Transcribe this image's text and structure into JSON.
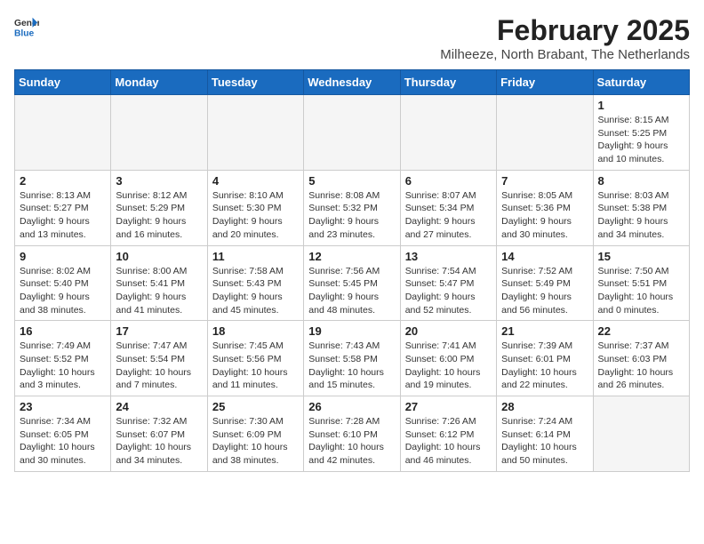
{
  "logo": {
    "general": "General",
    "blue": "Blue"
  },
  "title": "February 2025",
  "subtitle": "Milheeze, North Brabant, The Netherlands",
  "days_header": [
    "Sunday",
    "Monday",
    "Tuesday",
    "Wednesday",
    "Thursday",
    "Friday",
    "Saturday"
  ],
  "weeks": [
    [
      {
        "num": "",
        "info": ""
      },
      {
        "num": "",
        "info": ""
      },
      {
        "num": "",
        "info": ""
      },
      {
        "num": "",
        "info": ""
      },
      {
        "num": "",
        "info": ""
      },
      {
        "num": "",
        "info": ""
      },
      {
        "num": "1",
        "info": "Sunrise: 8:15 AM\nSunset: 5:25 PM\nDaylight: 9 hours and 10 minutes."
      }
    ],
    [
      {
        "num": "2",
        "info": "Sunrise: 8:13 AM\nSunset: 5:27 PM\nDaylight: 9 hours and 13 minutes."
      },
      {
        "num": "3",
        "info": "Sunrise: 8:12 AM\nSunset: 5:29 PM\nDaylight: 9 hours and 16 minutes."
      },
      {
        "num": "4",
        "info": "Sunrise: 8:10 AM\nSunset: 5:30 PM\nDaylight: 9 hours and 20 minutes."
      },
      {
        "num": "5",
        "info": "Sunrise: 8:08 AM\nSunset: 5:32 PM\nDaylight: 9 hours and 23 minutes."
      },
      {
        "num": "6",
        "info": "Sunrise: 8:07 AM\nSunset: 5:34 PM\nDaylight: 9 hours and 27 minutes."
      },
      {
        "num": "7",
        "info": "Sunrise: 8:05 AM\nSunset: 5:36 PM\nDaylight: 9 hours and 30 minutes."
      },
      {
        "num": "8",
        "info": "Sunrise: 8:03 AM\nSunset: 5:38 PM\nDaylight: 9 hours and 34 minutes."
      }
    ],
    [
      {
        "num": "9",
        "info": "Sunrise: 8:02 AM\nSunset: 5:40 PM\nDaylight: 9 hours and 38 minutes."
      },
      {
        "num": "10",
        "info": "Sunrise: 8:00 AM\nSunset: 5:41 PM\nDaylight: 9 hours and 41 minutes."
      },
      {
        "num": "11",
        "info": "Sunrise: 7:58 AM\nSunset: 5:43 PM\nDaylight: 9 hours and 45 minutes."
      },
      {
        "num": "12",
        "info": "Sunrise: 7:56 AM\nSunset: 5:45 PM\nDaylight: 9 hours and 48 minutes."
      },
      {
        "num": "13",
        "info": "Sunrise: 7:54 AM\nSunset: 5:47 PM\nDaylight: 9 hours and 52 minutes."
      },
      {
        "num": "14",
        "info": "Sunrise: 7:52 AM\nSunset: 5:49 PM\nDaylight: 9 hours and 56 minutes."
      },
      {
        "num": "15",
        "info": "Sunrise: 7:50 AM\nSunset: 5:51 PM\nDaylight: 10 hours and 0 minutes."
      }
    ],
    [
      {
        "num": "16",
        "info": "Sunrise: 7:49 AM\nSunset: 5:52 PM\nDaylight: 10 hours and 3 minutes."
      },
      {
        "num": "17",
        "info": "Sunrise: 7:47 AM\nSunset: 5:54 PM\nDaylight: 10 hours and 7 minutes."
      },
      {
        "num": "18",
        "info": "Sunrise: 7:45 AM\nSunset: 5:56 PM\nDaylight: 10 hours and 11 minutes."
      },
      {
        "num": "19",
        "info": "Sunrise: 7:43 AM\nSunset: 5:58 PM\nDaylight: 10 hours and 15 minutes."
      },
      {
        "num": "20",
        "info": "Sunrise: 7:41 AM\nSunset: 6:00 PM\nDaylight: 10 hours and 19 minutes."
      },
      {
        "num": "21",
        "info": "Sunrise: 7:39 AM\nSunset: 6:01 PM\nDaylight: 10 hours and 22 minutes."
      },
      {
        "num": "22",
        "info": "Sunrise: 7:37 AM\nSunset: 6:03 PM\nDaylight: 10 hours and 26 minutes."
      }
    ],
    [
      {
        "num": "23",
        "info": "Sunrise: 7:34 AM\nSunset: 6:05 PM\nDaylight: 10 hours and 30 minutes."
      },
      {
        "num": "24",
        "info": "Sunrise: 7:32 AM\nSunset: 6:07 PM\nDaylight: 10 hours and 34 minutes."
      },
      {
        "num": "25",
        "info": "Sunrise: 7:30 AM\nSunset: 6:09 PM\nDaylight: 10 hours and 38 minutes."
      },
      {
        "num": "26",
        "info": "Sunrise: 7:28 AM\nSunset: 6:10 PM\nDaylight: 10 hours and 42 minutes."
      },
      {
        "num": "27",
        "info": "Sunrise: 7:26 AM\nSunset: 6:12 PM\nDaylight: 10 hours and 46 minutes."
      },
      {
        "num": "28",
        "info": "Sunrise: 7:24 AM\nSunset: 6:14 PM\nDaylight: 10 hours and 50 minutes."
      },
      {
        "num": "",
        "info": ""
      }
    ]
  ]
}
